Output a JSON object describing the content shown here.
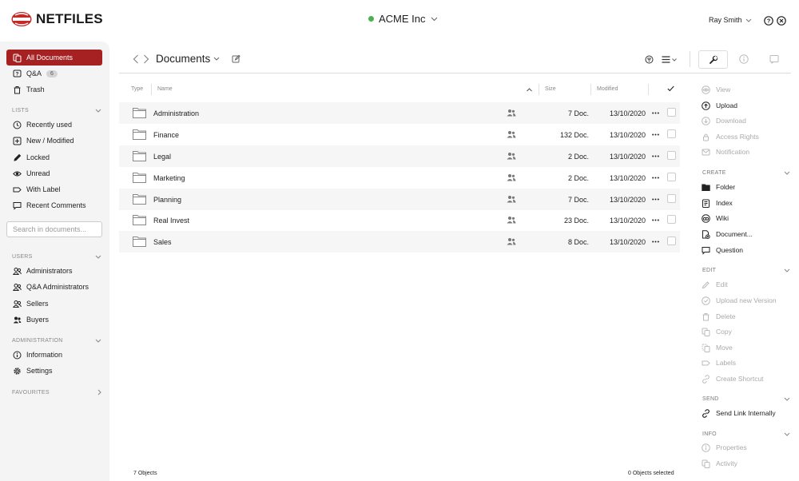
{
  "brand": {
    "name": "NETFILES",
    "color": "#c62828"
  },
  "workspace": {
    "name": "ACME Inc",
    "status_color": "#4caf50"
  },
  "user": {
    "name": "Ray Smith"
  },
  "sidebar": {
    "main": [
      {
        "label": "All Documents",
        "icon": "documents-icon",
        "active": true
      },
      {
        "label": "Q&A",
        "icon": "qa-icon",
        "badge": "6"
      },
      {
        "label": "Trash",
        "icon": "trash-icon"
      }
    ],
    "lists_header": "LISTS",
    "lists": [
      {
        "label": "Recently used",
        "icon": "clock-icon"
      },
      {
        "label": "New / Modified",
        "icon": "plus-icon"
      },
      {
        "label": "Locked",
        "icon": "pencil-icon"
      },
      {
        "label": "Unread",
        "icon": "eye-icon"
      },
      {
        "label": "With Label",
        "icon": "label-icon"
      },
      {
        "label": "Recent Comments",
        "icon": "comment-icon"
      }
    ],
    "search_placeholder": "Search in documents...",
    "users_header": "USERS",
    "users": [
      {
        "label": "Administrators",
        "icon": "users-icon"
      },
      {
        "label": "Q&A Administrators",
        "icon": "users-icon"
      },
      {
        "label": "Sellers",
        "icon": "users-icon"
      },
      {
        "label": "Buyers",
        "icon": "users-icon"
      }
    ],
    "admin_header": "ADMINISTRATION",
    "admin": [
      {
        "label": "Information",
        "icon": "info-icon"
      },
      {
        "label": "Settings",
        "icon": "gear-icon"
      }
    ],
    "favourites_header": "FAVOURITES"
  },
  "main": {
    "title": "Documents",
    "columns": {
      "type": "Type",
      "name": "Name",
      "size": "Size",
      "modified": "Modified"
    },
    "rows": [
      {
        "name": "Administration",
        "size": "7 Doc.",
        "modified": "13/10/2020"
      },
      {
        "name": "Finance",
        "size": "132 Doc.",
        "modified": "13/10/2020"
      },
      {
        "name": "Legal",
        "size": "2 Doc.",
        "modified": "13/10/2020"
      },
      {
        "name": "Marketing",
        "size": "2 Doc.",
        "modified": "13/10/2020"
      },
      {
        "name": "Planning",
        "size": "7 Doc.",
        "modified": "13/10/2020"
      },
      {
        "name": "Real Invest",
        "size": "23 Doc.",
        "modified": "13/10/2020"
      },
      {
        "name": "Sales",
        "size": "8 Doc.",
        "modified": "13/10/2020"
      }
    ],
    "object_count": "7 Objects",
    "selected_count": "0 Objects selected"
  },
  "actions": {
    "top": [
      {
        "label": "View",
        "icon": "eye-icon",
        "enabled": false
      },
      {
        "label": "Upload",
        "icon": "upload-icon",
        "enabled": true
      },
      {
        "label": "Download",
        "icon": "download-icon",
        "enabled": false
      },
      {
        "label": "Access Rights",
        "icon": "lock-icon",
        "enabled": false
      },
      {
        "label": "Notification",
        "icon": "mail-icon",
        "enabled": false
      }
    ],
    "create_header": "CREATE",
    "create": [
      {
        "label": "Folder",
        "icon": "folder-plus-icon",
        "enabled": true
      },
      {
        "label": "Index",
        "icon": "index-icon",
        "enabled": true
      },
      {
        "label": "Wiki",
        "icon": "wiki-icon",
        "enabled": true
      },
      {
        "label": "Document...",
        "icon": "document-plus-icon",
        "enabled": true
      },
      {
        "label": "Question",
        "icon": "question-icon",
        "enabled": true
      }
    ],
    "edit_header": "EDIT",
    "edit": [
      {
        "label": "Edit",
        "icon": "pencil-icon",
        "enabled": false
      },
      {
        "label": "Upload new Version",
        "icon": "version-icon",
        "enabled": false
      },
      {
        "label": "Delete",
        "icon": "trash-icon",
        "enabled": false
      },
      {
        "label": "Copy",
        "icon": "copy-icon",
        "enabled": false
      },
      {
        "label": "Move",
        "icon": "move-icon",
        "enabled": false
      },
      {
        "label": "Labels",
        "icon": "label-icon",
        "enabled": false
      },
      {
        "label": "Create Shortcut",
        "icon": "link-icon",
        "enabled": false
      }
    ],
    "send_header": "SEND",
    "send": [
      {
        "label": "Send Link Internally",
        "icon": "link-icon",
        "enabled": true
      }
    ],
    "info_header": "INFO",
    "info": [
      {
        "label": "Properties",
        "icon": "info-icon",
        "enabled": false
      },
      {
        "label": "Activity",
        "icon": "activity-icon",
        "enabled": false
      }
    ]
  }
}
